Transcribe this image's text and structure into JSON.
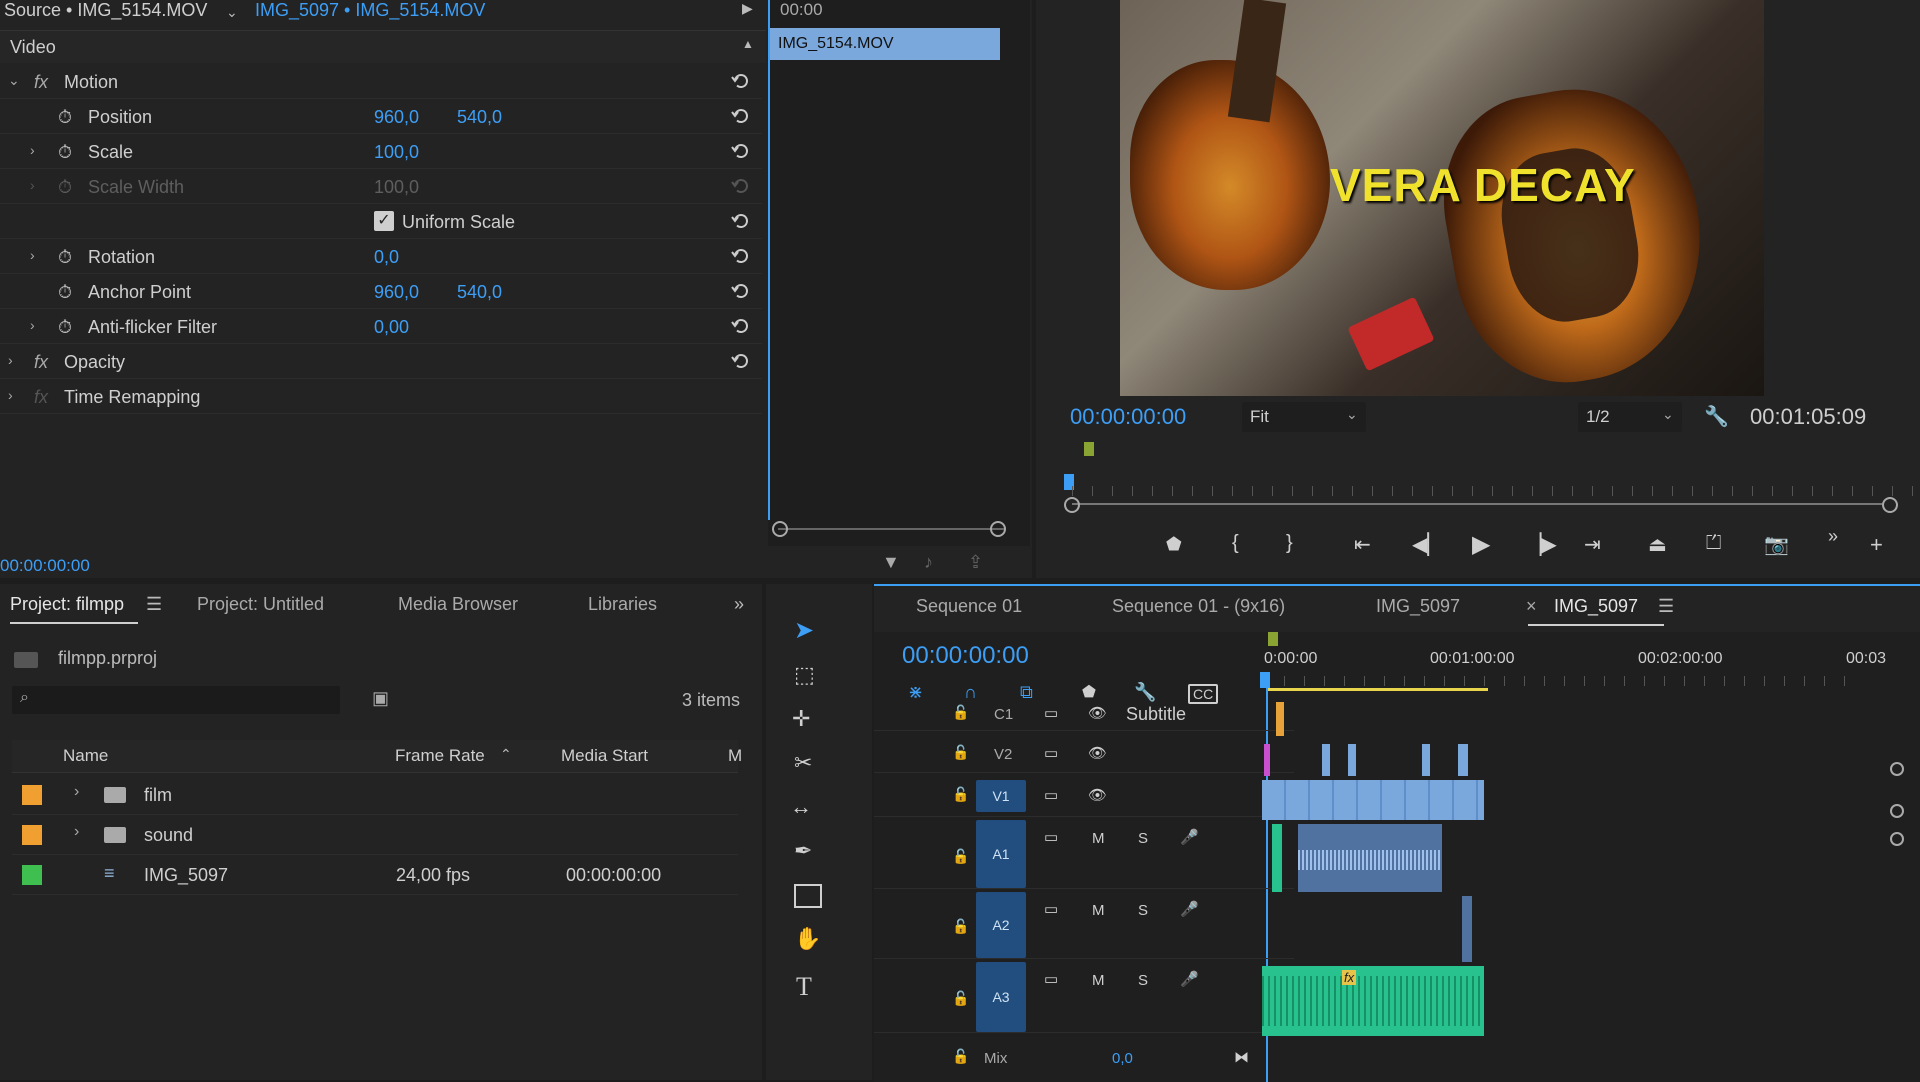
{
  "source_tab": {
    "label": "Source • IMG_5154.MOV",
    "clip_menu": "IMG_5097 • IMG_5154.MOV"
  },
  "effect_controls": {
    "section": "Video",
    "mini_timeline": {
      "time": "00:00",
      "clip": "IMG_5154.MOV"
    },
    "rows": [
      {
        "label": "Motion",
        "fx": true
      },
      {
        "label": "Position",
        "v1": "960,0",
        "v2": "540,0"
      },
      {
        "label": "Scale",
        "v1": "100,0"
      },
      {
        "label": "Scale Width",
        "v1": "100,0",
        "disabled": true
      },
      {
        "label": "Uniform Scale",
        "checkbox": true
      },
      {
        "label": "Rotation",
        "v1": "0,0"
      },
      {
        "label": "Anchor Point",
        "v1": "960,0",
        "v2": "540,0"
      },
      {
        "label": "Anti-flicker Filter",
        "v1": "0,00"
      },
      {
        "label": "Opacity",
        "fx": true
      },
      {
        "label": "Time Remapping",
        "fx": true
      }
    ],
    "current_time": "00:00:00:00"
  },
  "program_monitor": {
    "overlay_text": "VERA DECAY",
    "timecode": "00:00:00:00",
    "fit": "Fit",
    "resolution": "1/2",
    "duration": "00:01:05:09"
  },
  "project_panel": {
    "tabs": [
      "Project: filmpp",
      "Project: Untitled",
      "Media Browser",
      "Libraries"
    ],
    "file": "filmpp.prproj",
    "items_count": "3 items",
    "columns": [
      "Name",
      "Frame Rate",
      "Media Start",
      "M"
    ],
    "rows": [
      {
        "name": "film",
        "type": "folder",
        "color": "#f0a030",
        "frame_rate": "",
        "media_start": ""
      },
      {
        "name": "sound",
        "type": "folder",
        "color": "#f0a030",
        "frame_rate": "",
        "media_start": ""
      },
      {
        "name": "IMG_5097",
        "type": "sequence",
        "color": "#3fbf4f",
        "frame_rate": "24,00 fps",
        "media_start": "00:00:00:00"
      }
    ]
  },
  "timeline": {
    "tabs": [
      "Sequence 01",
      "Sequence 01 - (9x16)",
      "IMG_5097",
      "IMG_5097"
    ],
    "timecode": "00:00:00:00",
    "ruler": [
      "0:00:00",
      "00:01:00:00",
      "00:02:00:00",
      "00:03"
    ],
    "tracks": {
      "subtitle": {
        "label": "C1",
        "name": "Subtitle"
      },
      "video": [
        "V2",
        "V1"
      ],
      "audio": [
        "A1",
        "A2",
        "A3"
      ],
      "mute": "M",
      "solo": "S",
      "mix": "Mix",
      "mix_value": "0,0"
    }
  },
  "colors": {
    "accent": "#3d9ef5",
    "panel": "#232323",
    "track_blue": "#214e7e",
    "clip_blue": "#7aa8dc",
    "clip_green": "#27c28e"
  }
}
